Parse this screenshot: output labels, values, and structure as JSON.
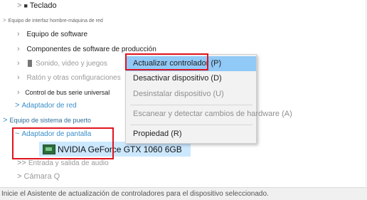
{
  "tree": {
    "teclado": "Teclado",
    "equipo_interfaz": "Equipo de interfaz hombre-máquina de red",
    "equipo_software": "Equipo de software",
    "componentes": "Componentes de software de producción",
    "sonido": "Sonido, video y juegos",
    "raton": "Ratón y otras configuraciones",
    "bus_serie": "Control de bus serie universal",
    "adaptador_red": "Adaptador de red",
    "sistema_puerto": "Equipo de sistema de puerto",
    "adaptador_pantalla": "Adaptador de pantalla",
    "gpu": "NVIDIA GeForce GTX 1060 6GB",
    "entrada_salida": "Entrada y salida de audio",
    "camara": "Cámara Q"
  },
  "context_menu": {
    "update_driver": "Actualizar controlador (P)",
    "disable_device": "Desactivar dispositivo (D)",
    "uninstall_device": "Desinstalar dispositivo (U)",
    "scan_hardware": "Escanear y detectar cambios de hardware (A)",
    "properties": "Propiedad (R)"
  },
  "status_bar": {
    "text": "Inicie el Asistente de actualización de controladores para el dispositivo seleccionado."
  },
  "colors": {
    "highlight": "#91c9f7",
    "selection": "#cce8ff",
    "annotation_red": "#e0141e",
    "tree_blue": "#3a8fc9"
  }
}
